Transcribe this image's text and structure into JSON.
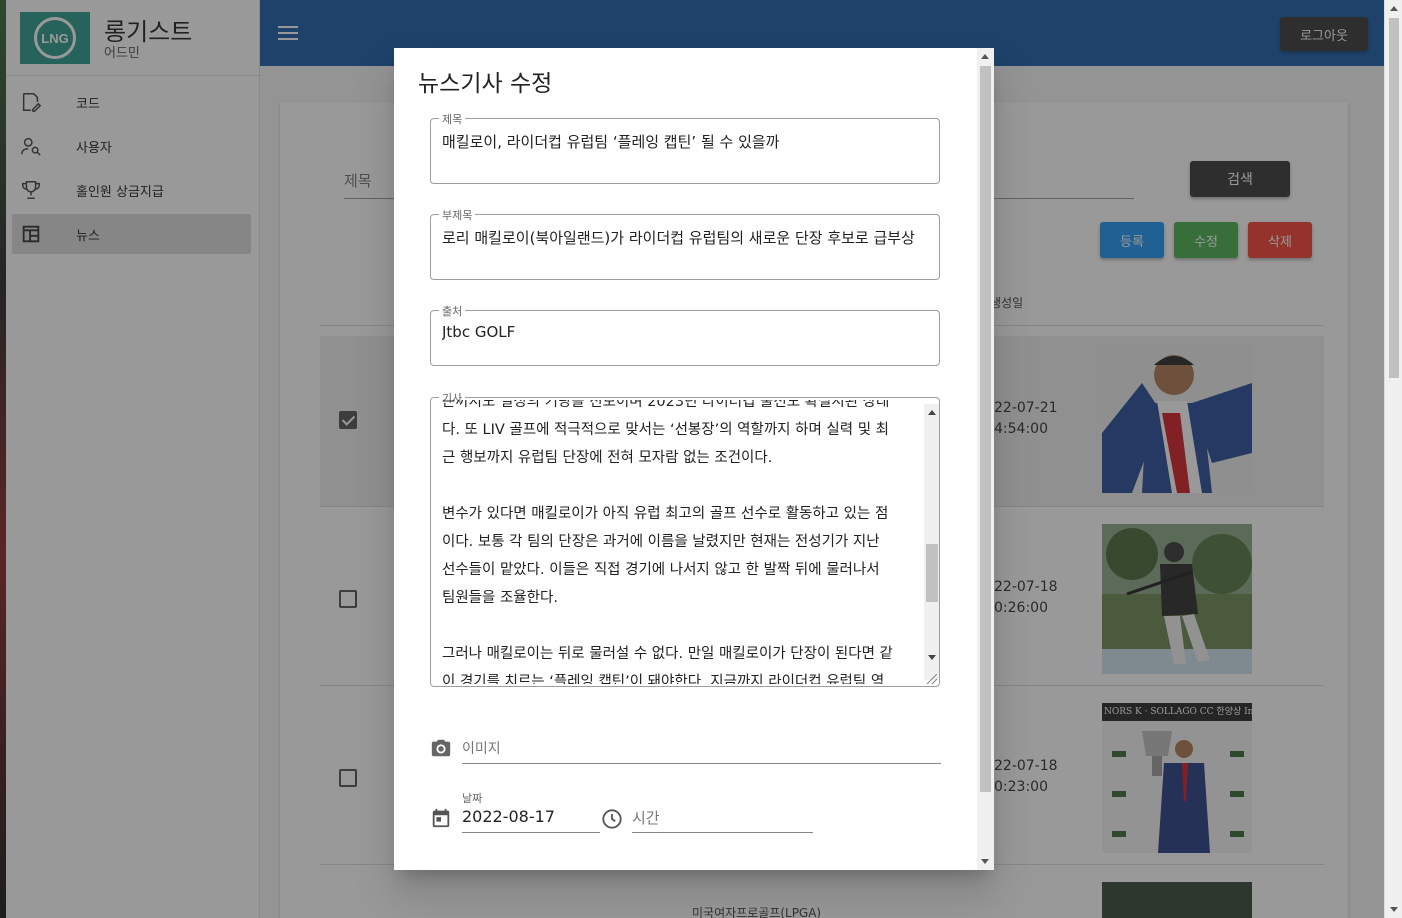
{
  "sidebar": {
    "logo_text": "LNG",
    "brand_title": "롱기스트",
    "brand_sub": "어드민",
    "items": [
      {
        "label": "코드",
        "icon": "code-edit-icon"
      },
      {
        "label": "사용자",
        "icon": "user-search-icon"
      },
      {
        "label": "홀인원 상금지급",
        "icon": "trophy-icon"
      },
      {
        "label": "뉴스",
        "icon": "news-table-icon",
        "active": true
      }
    ]
  },
  "header": {
    "menu_icon": "hamburger-menu-icon",
    "logout_label": "로그아웃"
  },
  "main": {
    "search_placeholder": "제목",
    "search_button": "검색",
    "register_button": "등록",
    "edit_button": "수정",
    "delete_button": "삭제",
    "column_header": "생성일",
    "rows": [
      {
        "checked": true,
        "date": "22-07-21",
        "time": "4:54:00"
      },
      {
        "checked": false,
        "date": "22-07-18",
        "time": "0:26:00"
      },
      {
        "checked": false,
        "date": "22-07-18",
        "time": "0:23:00",
        "thumb_caption": "NORS K · SOLLAGO CC 한양상 Invi"
      }
    ],
    "partial_row_text": "미국여자프로골프(LPGA)"
  },
  "modal": {
    "title": "뉴스기사 수정",
    "title_field": {
      "legend": "제목",
      "value": "매킬로이, 라이더컵 유럽팀 ‘플레잉 캡틴’ 될 수 있을까"
    },
    "subtitle_field": {
      "legend": "부제목",
      "value": "로리 매킬로이(북아일랜드)가 라이더컵 유럽팀의 새로운 단장 후보로 급부상"
    },
    "source_field": {
      "legend": "출처",
      "value": "Jtbc GOLF"
    },
    "article_field": {
      "legend": "기사",
      "text": "는까지도 일정의 기량을 선보이며 2023년 라이더컵 출전도 확실시된 상태\n다. 또 LIV 골프에 적극적으로 맞서는 ‘선봉장’의 역할까지 하며 실력 및 최\n근 행보까지 유럽팀 단장에 전혀 모자람 없는 조건이다.\n\n변수가 있다면 매킬로이가 아직 유럽 최고의 골프 선수로 활동하고 있는 점\n이다. 보통 각 팀의 단장은 과거에 이름을 날렸지만 현재는 전성기가 지난\n선수들이 맡았다. 이들은 직접 경기에 나서지 않고 한 발짝 뒤에 물러나서\n팀원들을 조율한다.\n\n그러나 매킬로이는 뒤로 물러설 수 없다. 만일 매킬로이가 단장이 된다면 같\n이 경기를 치르는 ‘플레잉 캡틴’이 돼야한다. 지금까지 라이더컵 유럽팀 역"
    },
    "image_field": {
      "placeholder": "이미지",
      "icon": "camera-icon"
    },
    "date_field": {
      "label": "날짜",
      "value": "2022-08-17",
      "icon": "calendar-icon"
    },
    "time_field": {
      "placeholder": "시간",
      "icon": "clock-icon"
    }
  }
}
